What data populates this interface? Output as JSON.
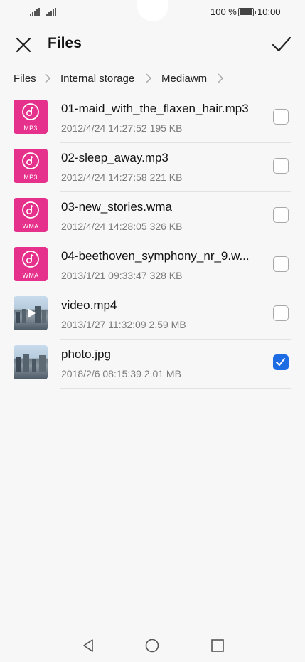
{
  "status_bar": {
    "battery_percent": "100 %",
    "time": "10:00",
    "icons": [
      "signal-icon",
      "signal-icon",
      "battery-icon"
    ]
  },
  "header": {
    "title": "Files",
    "close_icon": "close-icon",
    "confirm_icon": "checkmark-icon"
  },
  "breadcrumb": [
    "Files",
    "Internal storage",
    "Mediawm"
  ],
  "files": [
    {
      "name": "01-maid_with_the_flaxen_hair.mp3",
      "date": "2012/4/24 14:27:52",
      "size": "195 KB",
      "type": "MP3",
      "kind": "music",
      "checked": false
    },
    {
      "name": "02-sleep_away.mp3",
      "date": "2012/4/24 14:27:58",
      "size": "221 KB",
      "type": "MP3",
      "kind": "music",
      "checked": false
    },
    {
      "name": "03-new_stories.wma",
      "date": "2012/4/24 14:28:05",
      "size": "326 KB",
      "type": "WMA",
      "kind": "music",
      "checked": false
    },
    {
      "name": "04-beethoven_symphony_nr_9.w...",
      "date": "2013/1/21 09:33:47",
      "size": "328 KB",
      "type": "WMA",
      "kind": "music",
      "checked": false
    },
    {
      "name": "video.mp4",
      "date": "2013/1/27 11:32:09",
      "size": "2.59 MB",
      "type": "",
      "kind": "video",
      "checked": false
    },
    {
      "name": "photo.jpg",
      "date": "2018/2/6 08:15:39",
      "size": "2.01 MB",
      "type": "",
      "kind": "image",
      "checked": true
    }
  ],
  "nav": [
    "back-icon",
    "home-icon",
    "recents-icon"
  ],
  "colors": {
    "accent": "#1d6ce4",
    "music_tile": "#e5318b"
  }
}
